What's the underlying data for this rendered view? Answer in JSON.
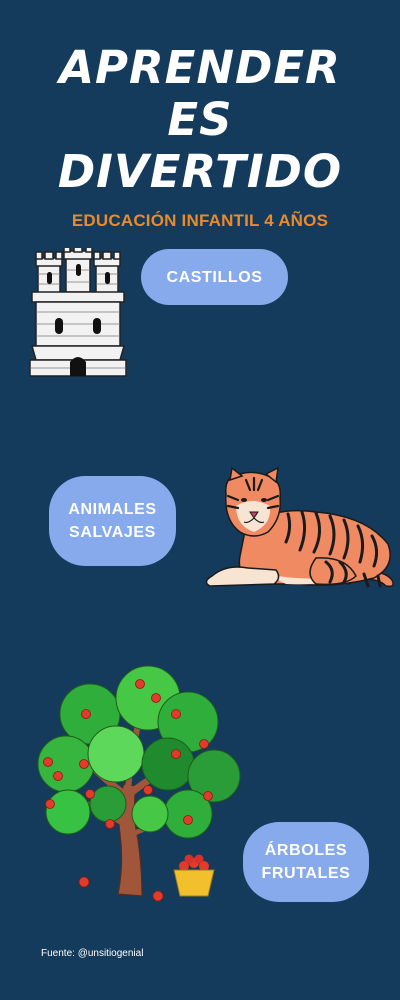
{
  "title": {
    "line1": "APRENDER",
    "line2": "ES",
    "line3": "DIVERTIDO"
  },
  "subtitle": "EDUCACIÓN INFANTIL 4 AÑOS",
  "cards": {
    "castillos": {
      "label": "CASTILLOS",
      "icon": "castle-icon"
    },
    "animales": {
      "line1": "ANIMALES",
      "line2": "SALVAJES",
      "icon": "tiger-icon"
    },
    "arboles": {
      "line1": "ÁRBOLES",
      "line2": "FRUTALES",
      "icon": "fruit-tree-icon"
    }
  },
  "footer": {
    "source": "Fuente: @unsitiogenial"
  },
  "colors": {
    "background": "#143a5c",
    "title": "#ffffff",
    "subtitle": "#e98a2c",
    "pill": "#86aaeb"
  }
}
